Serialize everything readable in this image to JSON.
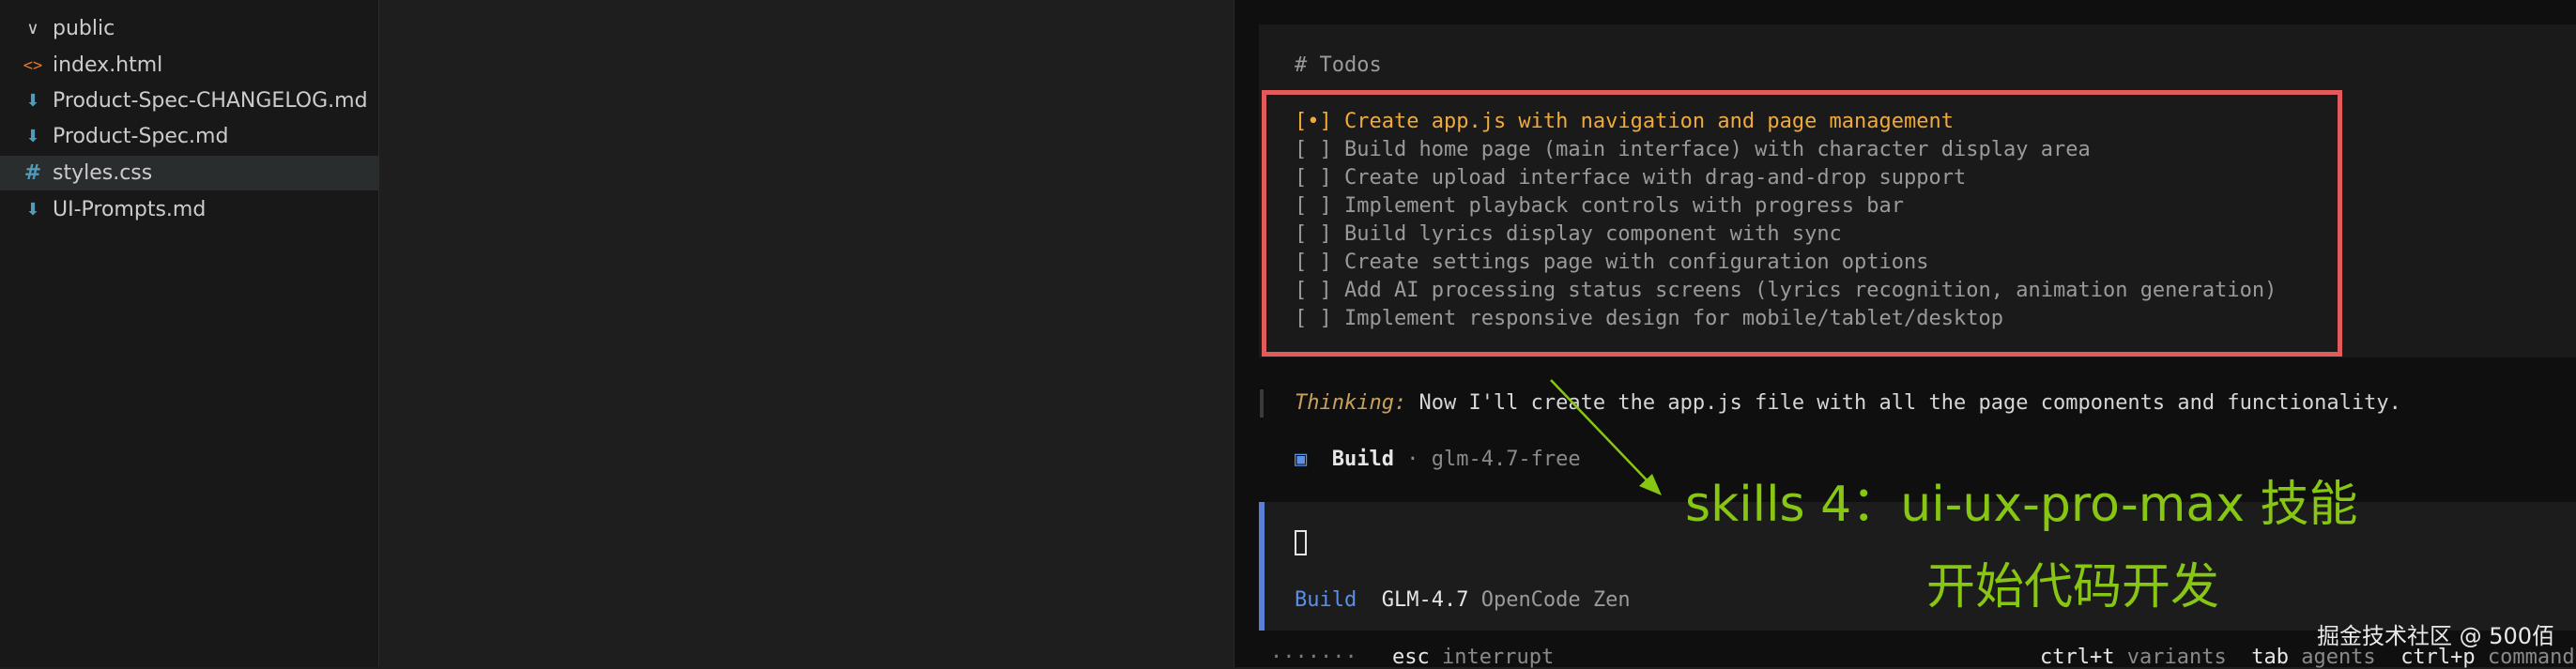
{
  "explorer": {
    "items": [
      {
        "icon": "chevron-down-icon",
        "glyph": "∨",
        "label": "public"
      },
      {
        "icon": "html-file-icon",
        "glyph": "<>",
        "label": "index.html"
      },
      {
        "icon": "markdown-file-icon",
        "glyph": "⬇",
        "label": "Product-Spec-CHANGELOG.md"
      },
      {
        "icon": "markdown-file-icon",
        "glyph": "⬇",
        "label": "Product-Spec.md"
      },
      {
        "icon": "css-file-icon",
        "glyph": "#",
        "label": "styles.css",
        "selected": true
      },
      {
        "icon": "markdown-file-icon",
        "glyph": "⬇",
        "label": "UI-Prompts.md"
      }
    ]
  },
  "terminal": {
    "todos_header": "# Todos",
    "todos": [
      {
        "mark": "[•]",
        "text": "Create app.js with navigation and page management",
        "active": true
      },
      {
        "mark": "[ ]",
        "text": "Build home page (main interface) with character display area"
      },
      {
        "mark": "[ ]",
        "text": "Create upload interface with drag-and-drop support"
      },
      {
        "mark": "[ ]",
        "text": "Implement playback controls with progress bar"
      },
      {
        "mark": "[ ]",
        "text": "Build lyrics display component with sync"
      },
      {
        "mark": "[ ]",
        "text": "Create settings page with configuration options"
      },
      {
        "mark": "[ ]",
        "text": "Add AI processing status screens (lyrics recognition, animation generation)"
      },
      {
        "mark": "[ ]",
        "text": "Implement responsive design for mobile/tablet/desktop"
      }
    ],
    "thinking_label": "Thinking:",
    "thinking_text": " Now I'll create the app.js file with all the page components and functionality.",
    "build_square": "▣",
    "build_title": "Build",
    "build_model": " · glm-4.7-free",
    "status_agent": "Build",
    "status_model": "GLM-4.7",
    "status_provider": "OpenCode Zen",
    "dots": "·······",
    "esc_key": "esc",
    "esc_desc": "interrupt",
    "hints": [
      {
        "key": "ctrl+t",
        "desc": "variants"
      },
      {
        "key": "tab",
        "desc": "agents"
      },
      {
        "key": "ctrl+p",
        "desc": "commands"
      }
    ]
  },
  "annotation": {
    "line1": "skills 4：ui-ux-pro-max 技能",
    "line2": "开始代码开发",
    "color": "#88c614"
  },
  "watermark": "掘金技术社区 @ 500佰",
  "colors": {
    "todo_box_border": "#e35a5a",
    "active_todo": "#f0a93b",
    "agent_accent": "#5b8fe8"
  }
}
